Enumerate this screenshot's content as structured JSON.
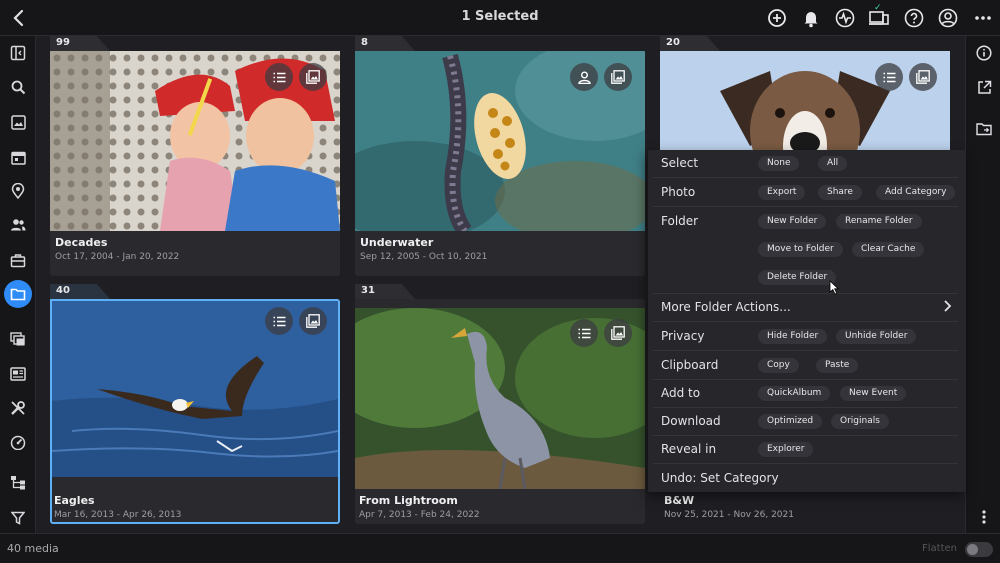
{
  "header": {
    "title": "1 Selected"
  },
  "icons": {
    "back": "chevron-left-icon",
    "add": "plus-circle-icon",
    "notifications": "bell-icon",
    "activity": "activity-icon",
    "devices": "devices-icon",
    "help": "help-icon",
    "account": "account-icon",
    "more": "more-horizontal-icon"
  },
  "sidebar": {
    "items": [
      {
        "name": "sidebar-toggle",
        "icon": "panel-icon"
      },
      {
        "name": "search",
        "icon": "search-icon"
      },
      {
        "name": "photos",
        "icon": "image-icon"
      },
      {
        "name": "calendar",
        "icon": "calendar-icon"
      },
      {
        "name": "places",
        "icon": "map-pin-icon"
      },
      {
        "name": "people",
        "icon": "people-icon"
      },
      {
        "name": "albums",
        "icon": "toolbox-icon"
      },
      {
        "name": "folders",
        "icon": "folder-icon",
        "active": true
      },
      {
        "name": "collections",
        "icon": "stack-icon"
      },
      {
        "name": "slideshow",
        "icon": "slides-icon"
      },
      {
        "name": "tools",
        "icon": "tools-icon"
      },
      {
        "name": "dashboard",
        "icon": "gauge-icon"
      },
      {
        "name": "tree",
        "icon": "tree-icon"
      },
      {
        "name": "filter",
        "icon": "filter-icon"
      }
    ]
  },
  "rightbar": {
    "items": [
      {
        "name": "info",
        "icon": "info-icon"
      },
      {
        "name": "open-external",
        "icon": "external-link-icon"
      },
      {
        "name": "move-to-folder",
        "icon": "folder-arrow-icon"
      },
      {
        "name": "overflow",
        "icon": "more-vertical-icon"
      }
    ]
  },
  "folders": [
    {
      "count": "99",
      "name": "Decades",
      "dates": "Oct 17, 2004 - Jan 20, 2022",
      "selected": false,
      "overlay": [
        "list-icon",
        "image-icon"
      ]
    },
    {
      "count": "8",
      "name": "Underwater",
      "dates": "Sep 12, 2005 - Oct 10, 2021",
      "selected": false,
      "overlay": [
        "person-icon",
        "image-icon"
      ]
    },
    {
      "count": "20",
      "name": "B&W",
      "dates": "Nov 25, 2021 - Nov 26, 2021",
      "selected": false,
      "overlay": [
        "list-icon",
        "image-icon"
      ]
    },
    {
      "count": "40",
      "name": "Eagles",
      "dates": "Mar 16, 2013 - Apr 26, 2013",
      "selected": true,
      "overlay": [
        "list-icon",
        "image-icon"
      ]
    },
    {
      "count": "31",
      "name": "From Lightroom",
      "dates": "Apr 7, 2013 - Feb 24, 2022",
      "selected": false,
      "overlay": [
        "list-icon",
        "image-icon"
      ]
    }
  ],
  "menu": {
    "select": {
      "label": "Select",
      "none": "None",
      "all": "All"
    },
    "photo": {
      "label": "Photo",
      "export": "Export",
      "share": "Share",
      "add_category": "Add Category"
    },
    "folder": {
      "label": "Folder",
      "new_folder": "New Folder",
      "rename_folder": "Rename Folder",
      "move_to_folder": "Move to Folder",
      "clear_cache": "Clear Cache",
      "delete_folder": "Delete Folder"
    },
    "more_folder_actions": "More Folder Actions...",
    "privacy": {
      "label": "Privacy",
      "hide_folder": "Hide Folder",
      "unhide_folder": "Unhide Folder"
    },
    "clipboard": {
      "label": "Clipboard",
      "copy": "Copy",
      "paste": "Paste"
    },
    "add_to": {
      "label": "Add to",
      "quickalbum": "QuickAlbum",
      "new_event": "New Event"
    },
    "download": {
      "label": "Download",
      "optimized": "Optimized",
      "originals": "Originals"
    },
    "reveal_in": {
      "label": "Reveal in",
      "explorer": "Explorer"
    },
    "undo": "Undo: Set Category"
  },
  "footer": {
    "media_count": "40 media",
    "flatten_label": "Flatten",
    "flatten_on": false
  },
  "colors": {
    "accent": "#2f8bf5",
    "selection_border": "#5fb0f5",
    "status_check": "#42d0a0"
  }
}
